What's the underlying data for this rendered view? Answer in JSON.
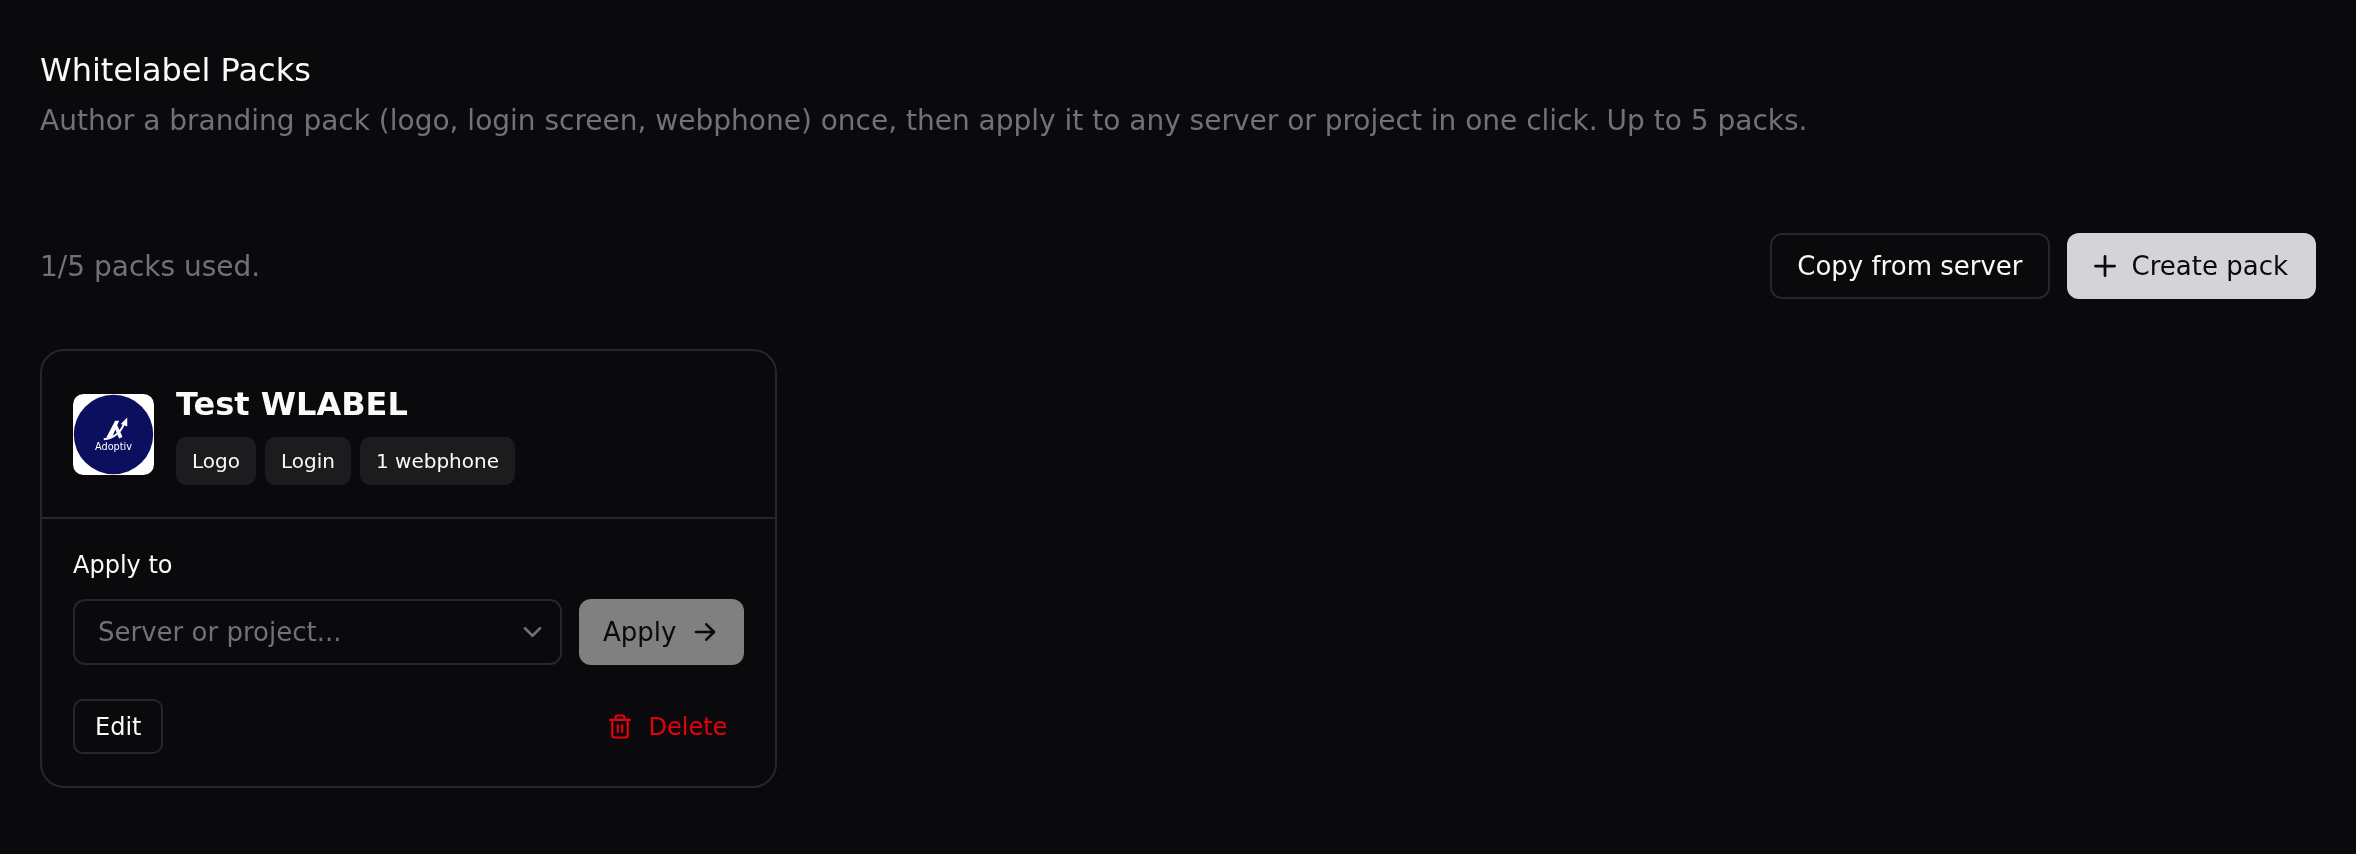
{
  "header": {
    "title": "Whitelabel Packs",
    "description": "Author a branding pack (logo, login screen, webphone) once, then apply it to any server or project in one click. Up to 5 packs."
  },
  "toolbar": {
    "usage": "1/5 packs used.",
    "buttons": [
      {
        "label": "Copy from server",
        "kind": "outline"
      },
      {
        "label": "Create pack",
        "kind": "primary"
      }
    ]
  },
  "packs": [
    {
      "name": "Test WLABEL",
      "logo_text": "Adoptiv",
      "tags": [
        "Logo",
        "Login",
        "1 webphone"
      ],
      "apply_label": "Apply to",
      "select": {
        "placeholder": "Server or project..."
      },
      "apply_button": {
        "label": "Apply",
        "disabled": true
      },
      "edit_button": "Edit",
      "delete_button": "Delete"
    }
  ]
}
